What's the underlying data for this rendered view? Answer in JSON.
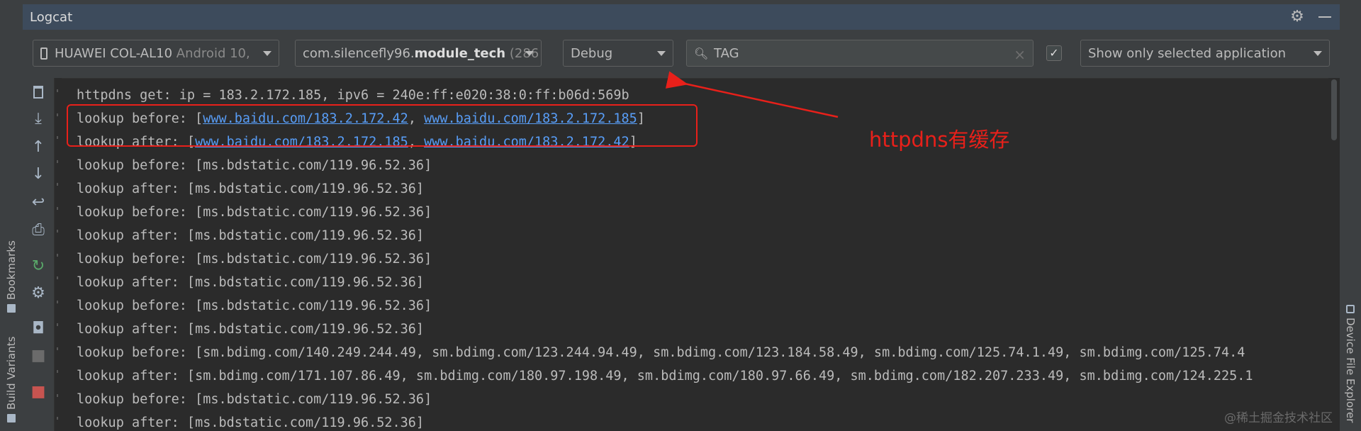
{
  "window": {
    "title": "Logcat"
  },
  "side_tabs": {
    "bookmarks": "Bookmarks",
    "build_variants": "Build Variants",
    "device_file_explorer": "Device File Explorer"
  },
  "toolbar": {
    "device": {
      "name": "HUAWEI COL-AL10",
      "detail": "Android 10,"
    },
    "process": {
      "prefix": "com.silencefly96.",
      "bold": "module_tech",
      "suffix": "(286"
    },
    "level": "Debug",
    "search": {
      "value": "TAG"
    },
    "regex_checked": true,
    "filter": "Show only selected application"
  },
  "icons": {
    "settings": "gear-icon",
    "minimize": "minimize-icon",
    "clear": "trash-icon",
    "scroll_end": "scroll-to-end-icon",
    "up": "arrow-up-icon",
    "down": "arrow-down-icon",
    "wrap": "soft-wrap-icon",
    "print": "print-icon",
    "restart": "restart-icon",
    "config": "gear-icon",
    "screenshot": "camera-icon",
    "record": "video-icon",
    "stop": "stop-icon"
  },
  "log": {
    "lines": [
      {
        "segments": [
          {
            "text": "httpdns get: ip = 183.2.172.185, ipv6 = 240e:ff:e020:38:0:ff:b06d:569b"
          }
        ]
      },
      {
        "segments": [
          {
            "text": "lookup before: ["
          },
          {
            "text": "www.baidu.com/183.2.172.42",
            "link": true
          },
          {
            "text": ", "
          },
          {
            "text": "www.baidu.com/183.2.172.185",
            "link": true
          },
          {
            "text": "]"
          }
        ]
      },
      {
        "segments": [
          {
            "text": "lookup after: ["
          },
          {
            "text": "www.baidu.com/183.2.172.185",
            "link": true
          },
          {
            "text": ", "
          },
          {
            "text": "www.baidu.com/183.2.172.42",
            "link": true
          },
          {
            "text": "]"
          }
        ]
      },
      {
        "segments": [
          {
            "text": "lookup before: [ms.bdstatic.com/119.96.52.36]"
          }
        ]
      },
      {
        "segments": [
          {
            "text": "lookup after: [ms.bdstatic.com/119.96.52.36]"
          }
        ]
      },
      {
        "segments": [
          {
            "text": "lookup before: [ms.bdstatic.com/119.96.52.36]"
          }
        ]
      },
      {
        "segments": [
          {
            "text": "lookup after: [ms.bdstatic.com/119.96.52.36]"
          }
        ]
      },
      {
        "segments": [
          {
            "text": "lookup before: [ms.bdstatic.com/119.96.52.36]"
          }
        ]
      },
      {
        "segments": [
          {
            "text": "lookup after: [ms.bdstatic.com/119.96.52.36]"
          }
        ]
      },
      {
        "segments": [
          {
            "text": "lookup before: [ms.bdstatic.com/119.96.52.36]"
          }
        ]
      },
      {
        "segments": [
          {
            "text": "lookup after: [ms.bdstatic.com/119.96.52.36]"
          }
        ]
      },
      {
        "segments": [
          {
            "text": "lookup before: [sm.bdimg.com/140.249.244.49, sm.bdimg.com/123.244.94.49, sm.bdimg.com/123.184.58.49, sm.bdimg.com/125.74.1.49, sm.bdimg.com/125.74.4"
          }
        ]
      },
      {
        "segments": [
          {
            "text": "lookup after: [sm.bdimg.com/171.107.86.49, sm.bdimg.com/180.97.198.49, sm.bdimg.com/180.97.66.49, sm.bdimg.com/182.207.233.49, sm.bdimg.com/124.225.1"
          }
        ]
      },
      {
        "segments": [
          {
            "text": "lookup before: [ms.bdstatic.com/119.96.52.36]"
          }
        ]
      },
      {
        "segments": [
          {
            "text": "lookup after: [ms.bdstatic.com/119.96.52.36]"
          }
        ]
      }
    ]
  },
  "annotation": "httpdns有缓存",
  "watermark": "@稀土掘金技术社区"
}
